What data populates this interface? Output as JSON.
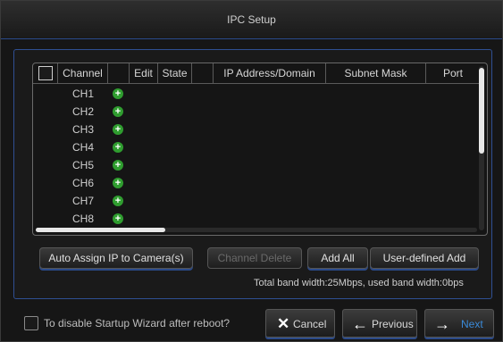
{
  "window": {
    "title": "IPC Setup"
  },
  "table": {
    "headers": [
      "",
      "Channel",
      "",
      "Edit",
      "State",
      "",
      "IP Address/Domain",
      "Subnet Mask",
      "Port"
    ],
    "rows": [
      "CH1",
      "CH2",
      "CH3",
      "CH4",
      "CH5",
      "CH6",
      "CH7",
      "CH8"
    ]
  },
  "buttons": {
    "auto_assign": "Auto Assign IP to Camera(s)",
    "channel_delete": "Channel Delete",
    "add_all": "Add All",
    "user_defined_add": "User-defined Add"
  },
  "bandwidth_text": "Total band width:25Mbps, used band width:0bps",
  "footer": {
    "disable_wizard_label": "To disable Startup Wizard after reboot?",
    "cancel": "Cancel",
    "previous": "Previous",
    "next": "Next"
  },
  "icons": {
    "add": "plus-circle-icon",
    "cancel": "x-icon",
    "previous": "arrow-left-icon",
    "next": "arrow-right-icon"
  },
  "colors": {
    "accent_blue": "#2f4f93",
    "add_green": "#2f9d2f",
    "next_blue": "#3a8ad8"
  }
}
